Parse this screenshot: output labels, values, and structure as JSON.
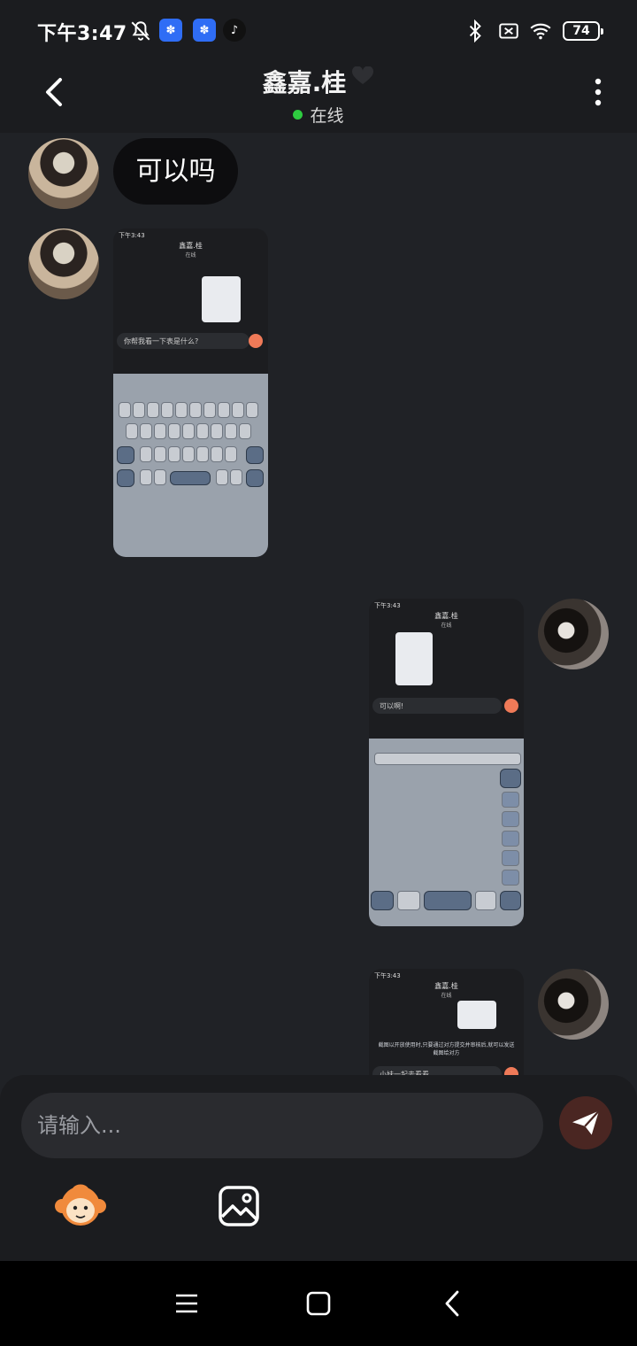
{
  "status_bar": {
    "time": "下午3:47",
    "battery_level": "74",
    "icons": [
      "bell-off-icon",
      "baidu-icon",
      "baidu-icon",
      "tiktok-icon",
      "bluetooth-icon",
      "no-sim-icon",
      "wifi-icon",
      "battery-icon"
    ]
  },
  "header": {
    "contact_name": "鑫嘉.桂",
    "status_text": "在线",
    "status_color": "#2ecc40"
  },
  "messages": [
    {
      "side": "left",
      "type": "text",
      "text": "可以吗"
    },
    {
      "side": "left",
      "type": "image",
      "description_icon": "screenshot-thumbnail"
    },
    {
      "side": "right",
      "type": "image",
      "description_icon": "screenshot-thumbnail"
    },
    {
      "side": "right",
      "type": "image",
      "description_icon": "screenshot-thumbnail"
    }
  ],
  "thumbnails": {
    "shot1": {
      "status": "下午3:43",
      "title": "鑫嘉.桂",
      "sub": "在线",
      "input_text": "你帮我看一下表是什么?"
    },
    "shot2": {
      "status": "下午3:43",
      "title": "鑫嘉.桂",
      "sub": "在线",
      "input_text": "可以啊!"
    },
    "shot3": {
      "status": "下午3:43",
      "title": "鑫嘉.桂",
      "sub": "在线",
      "caption": "截图以开放使用时,只要通过对方提交并审核后,就可以发送截图给对方",
      "input_text": "小妹一起去看看"
    }
  },
  "composer": {
    "placeholder": "请输入...",
    "send_color": "#ef7a58"
  }
}
